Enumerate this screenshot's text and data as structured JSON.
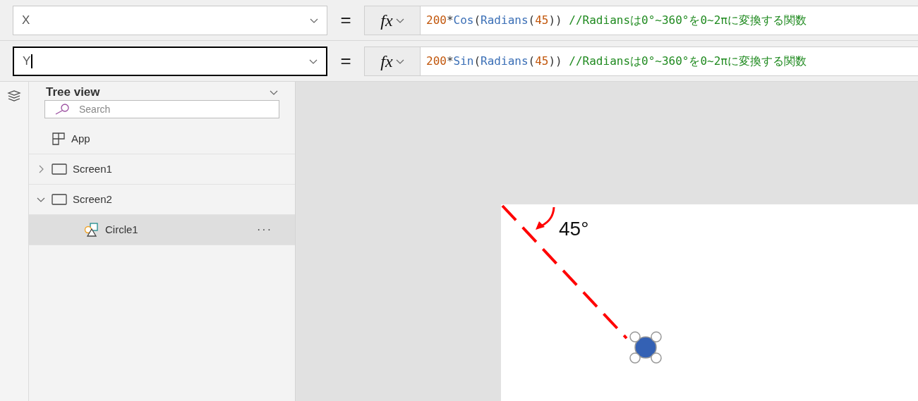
{
  "formula_bars": [
    {
      "property": "X",
      "focused": false,
      "equals": "=",
      "fx": "fx",
      "tokens": [
        {
          "kind": "number",
          "text": "200"
        },
        {
          "kind": "op",
          "text": "*"
        },
        {
          "kind": "function",
          "text": "Cos"
        },
        {
          "kind": "op",
          "text": "("
        },
        {
          "kind": "function",
          "text": "Radians"
        },
        {
          "kind": "op",
          "text": "("
        },
        {
          "kind": "number",
          "text": "45"
        },
        {
          "kind": "op",
          "text": "))"
        },
        {
          "kind": "comment",
          "text": " //Radiansは0°~360°を0~2πに変換する関数"
        }
      ]
    },
    {
      "property": "Y",
      "focused": true,
      "equals": "=",
      "fx": "fx",
      "tokens": [
        {
          "kind": "number",
          "text": "200"
        },
        {
          "kind": "op",
          "text": "*"
        },
        {
          "kind": "function",
          "text": "Sin"
        },
        {
          "kind": "op",
          "text": "("
        },
        {
          "kind": "function",
          "text": "Radians"
        },
        {
          "kind": "op",
          "text": "("
        },
        {
          "kind": "number",
          "text": "45"
        },
        {
          "kind": "op",
          "text": "))"
        },
        {
          "kind": "comment",
          "text": " //Radiansは0°~360°を0~2πに変換する関数"
        }
      ]
    }
  ],
  "tree_view": {
    "title": "Tree view",
    "search": {
      "placeholder": "Search"
    },
    "items": [
      {
        "kind": "app",
        "label": "App",
        "selected": false
      },
      {
        "kind": "screen",
        "label": "Screen1",
        "expanded": false,
        "selected": false
      },
      {
        "kind": "screen",
        "label": "Screen2",
        "expanded": true,
        "selected": false,
        "children": [
          {
            "kind": "circle",
            "label": "Circle1",
            "selected": true,
            "more": "···"
          }
        ]
      }
    ]
  },
  "canvas": {
    "angle_label": "45°"
  }
}
